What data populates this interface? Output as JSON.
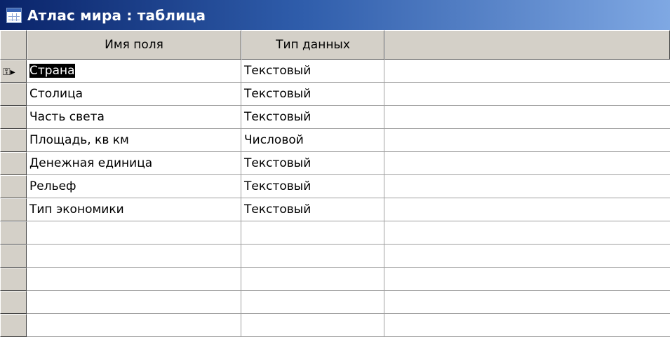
{
  "window": {
    "title": "Атлас мира : таблица",
    "icon": "table-icon"
  },
  "columns": {
    "field_name": "Имя поля",
    "data_type": "Тип данных",
    "description": ""
  },
  "rows": [
    {
      "name": "Страна",
      "type": "Текстовый",
      "primary_key": true,
      "selected": true
    },
    {
      "name": "Столица",
      "type": "Текстовый"
    },
    {
      "name": "Часть света",
      "type": "Текстовый"
    },
    {
      "name": "Площадь, кв км",
      "type": "Числовой"
    },
    {
      "name": "Денежная единица",
      "type": "Текстовый"
    },
    {
      "name": "Рельеф",
      "type": "Текстовый"
    },
    {
      "name": "Тип экономики",
      "type": "Текстовый"
    }
  ],
  "row_indicator": {
    "key_icon": "primary-key-icon",
    "current_icon": "current-row-arrow-icon"
  },
  "colors": {
    "title_start": "#0a246a",
    "title_end": "#7fa8e3",
    "header_bg": "#d4d0c8",
    "selection_bg": "#000000"
  }
}
